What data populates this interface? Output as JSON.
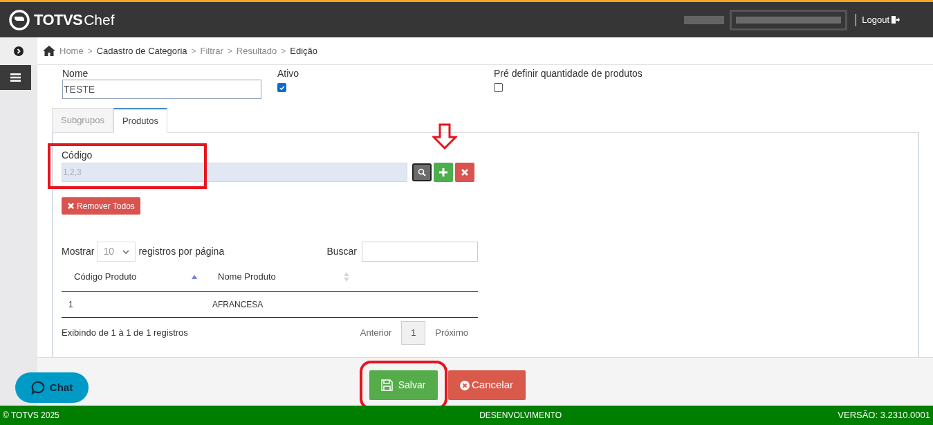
{
  "header": {
    "logo": {
      "brand": "TOTVS",
      "product": "Chef"
    },
    "logout": "Logout"
  },
  "breadcrumb": [
    {
      "label": "Home",
      "highlighted": false
    },
    {
      "separator": ">",
      "label": "Cadastro de Categoria",
      "highlighted": true
    },
    {
      "separator": ">",
      "label": "Filtrar",
      "highlighted": false
    },
    {
      "separator": ">",
      "label": "Resultado",
      "highlighted": false
    },
    {
      "separator": ">",
      "label": "Edição",
      "highlighted": true
    }
  ],
  "form": {
    "name": {
      "label": "Nome",
      "value": "TESTE"
    },
    "active": {
      "label": "Ativo",
      "checked": true
    },
    "preset_quantity": {
      "label": "Pré definir quantidade de produtos",
      "checked": false
    }
  },
  "tabs": [
    {
      "label": "Subgrupos",
      "selected": false
    },
    {
      "label": "Produtos",
      "selected": true
    }
  ],
  "code_field": {
    "label": "Código",
    "placeholder": "1,2,3"
  },
  "remove_all": "Remover Todos",
  "table": {
    "show_label": "Mostrar",
    "page_size": "10",
    "per_page_label": "registros por página",
    "search_label": "Buscar",
    "columns": [
      {
        "label": "Código Produto",
        "sorted": true
      },
      {
        "label": "Nome Produto",
        "sorted": false
      }
    ],
    "rows": [
      [
        "1",
        "AFRANCESA"
      ]
    ],
    "info": "Exibindo de 1 à 1 de 1 registros",
    "pagination": {
      "previous": "Anterior",
      "pages": [
        {
          "label": "1",
          "selected": true
        }
      ],
      "next": "Próximo"
    }
  },
  "actions": {
    "save": "Salvar",
    "cancel": "Cancelar"
  },
  "chat": "Chat",
  "footer": {
    "copyright": "© TOTVS 2025",
    "environment": "DESENVOLVIMENTO",
    "version": "VERSÃO: 3.2310.0001"
  }
}
